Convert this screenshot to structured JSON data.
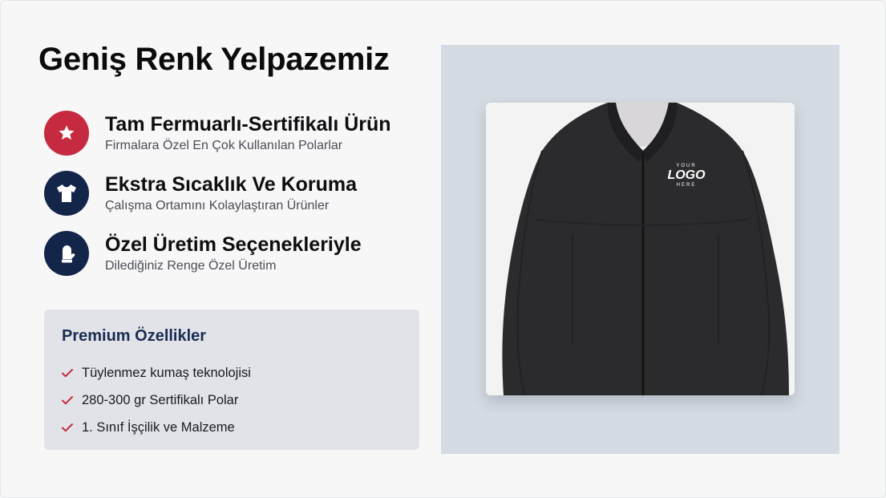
{
  "title": "Geniş Renk Yelpazemiz",
  "features": [
    {
      "heading": "Tam Fermuarlı-Sertifikalı Ürün",
      "sub": "Firmalara Özel En Çok Kullanılan Polarlar",
      "icon": "star-icon",
      "color": "#c62a40"
    },
    {
      "heading": "Ekstra Sıcaklık Ve Koruma",
      "sub": "Çalışma Ortamını Kolaylaştıran Ürünler",
      "icon": "tshirt-icon",
      "color": "#14254a"
    },
    {
      "heading": "Özel Üretim Seçenekleriyle",
      "sub": "Dilediğiniz Renge Özel Üretim",
      "icon": "mitten-icon",
      "color": "#14254a"
    }
  ],
  "premium": {
    "title": "Premium Özellikler",
    "items": [
      "Tüylenmez kumaş teknolojisi",
      "280-300 gr Sertifikalı Polar",
      "1. Sınıf İşçilik ve Malzeme"
    ],
    "check_color": "#c62a40"
  },
  "product_image": {
    "logo_top": "YOUR",
    "logo_main": "LOGO",
    "logo_bottom": "HERE"
  },
  "colors": {
    "accent_red": "#c62a40",
    "navy": "#14254a",
    "panel_bg": "#d5dbe3"
  }
}
